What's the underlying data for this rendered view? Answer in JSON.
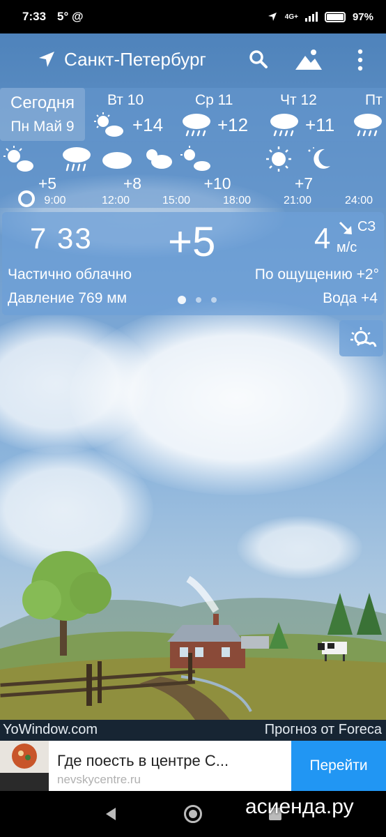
{
  "status_bar": {
    "time": "7:33",
    "indicators": "5° @",
    "network": "4G+",
    "battery": "97%"
  },
  "header": {
    "city": "Санкт-Петербург",
    "icons": [
      "location-arrow-icon",
      "search-icon",
      "landscape-icon",
      "more-vert-icon"
    ]
  },
  "days": {
    "today": {
      "label": "Сегодня",
      "date": "Пн Май 9"
    },
    "items": [
      {
        "name": "Вт 10",
        "temp": "+14",
        "icon": "partly-cloudy-icon"
      },
      {
        "name": "Ср 11",
        "temp": "+12",
        "icon": "rain-icon"
      },
      {
        "name": "Чт 12",
        "temp": "+11",
        "icon": "rain-icon"
      },
      {
        "name": "Пт",
        "temp": "",
        "icon": "rain-icon"
      }
    ]
  },
  "hours": {
    "temps": [
      "+5",
      "+8",
      "+10",
      "+7"
    ],
    "labels": [
      "9:00",
      "12:00",
      "15:00",
      "18:00",
      "21:00",
      "24:00"
    ],
    "icons": [
      "partly-cloudy-icon",
      "rain-icon",
      "cloud-icon",
      "partly-cloudy-icon",
      "partly-cloudy-icon",
      "sun-icon",
      "moon-icon"
    ]
  },
  "now": {
    "time": "7 33",
    "temp": "+5",
    "wind_speed": "4",
    "wind_dir": "СЗ",
    "wind_unit": "м/с",
    "description": "Частично облачно",
    "feels_like": "По ощущению +2°",
    "pressure": "Давление 769 мм",
    "water": "Вода +4"
  },
  "footer": {
    "brand": "YoWindow.com",
    "source": "Прогноз от Foreca"
  },
  "ad": {
    "title": "Где поесть в центре С...",
    "url": "nevskycentre.ru",
    "button": "Перейти"
  },
  "watermark": "асиенда.ру",
  "colors": {
    "panel": "#6ea0d7",
    "ad_button": "#2196f3",
    "footer": "#19283a"
  }
}
